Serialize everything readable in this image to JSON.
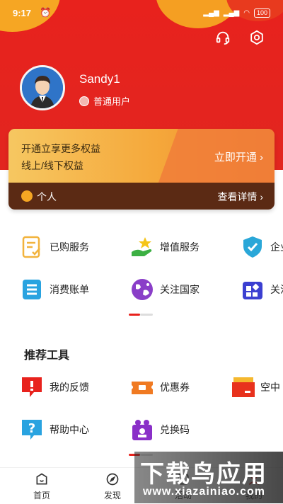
{
  "status": {
    "time": "9:17",
    "battery": "100"
  },
  "user": {
    "name": "Sandy1",
    "level": "普通用户"
  },
  "member_card": {
    "line1": "开通立享更多权益",
    "line2": "线上/线下权益",
    "open_label": "立即开通",
    "tier_label": "个人",
    "detail_label": "查看详情"
  },
  "services": [
    {
      "label": "已购服务",
      "icon": "document-icon"
    },
    {
      "label": "增值服务",
      "icon": "hand-star-icon"
    },
    {
      "label": "企业",
      "icon": "shield-check-icon"
    },
    {
      "label": "消费账单",
      "icon": "bill-icon"
    },
    {
      "label": "关注国家",
      "icon": "globe-icon"
    },
    {
      "label": "关注",
      "icon": "apps-icon"
    }
  ],
  "tools_title": "推荐工具",
  "tools": [
    {
      "label": "我的反馈",
      "icon": "feedback-icon"
    },
    {
      "label": "优惠券",
      "icon": "coupon-icon"
    },
    {
      "label": "空中",
      "icon": "air-icon"
    },
    {
      "label": "帮助中心",
      "icon": "help-icon"
    },
    {
      "label": "兑换码",
      "icon": "redeem-icon"
    }
  ],
  "nav": [
    {
      "label": "首页",
      "icon": "home-icon"
    },
    {
      "label": "发现",
      "icon": "compass-icon"
    },
    {
      "label": "活动",
      "icon": "activity-icon"
    },
    {
      "label": "我的",
      "icon": "profile-icon"
    }
  ],
  "watermark": {
    "title": "下载鸟应用",
    "url": "www.xiazainiao.com"
  },
  "colors": {
    "brand_red": "#e8221d",
    "accent_orange": "#f6a623",
    "card_dark": "#5b2a14"
  }
}
